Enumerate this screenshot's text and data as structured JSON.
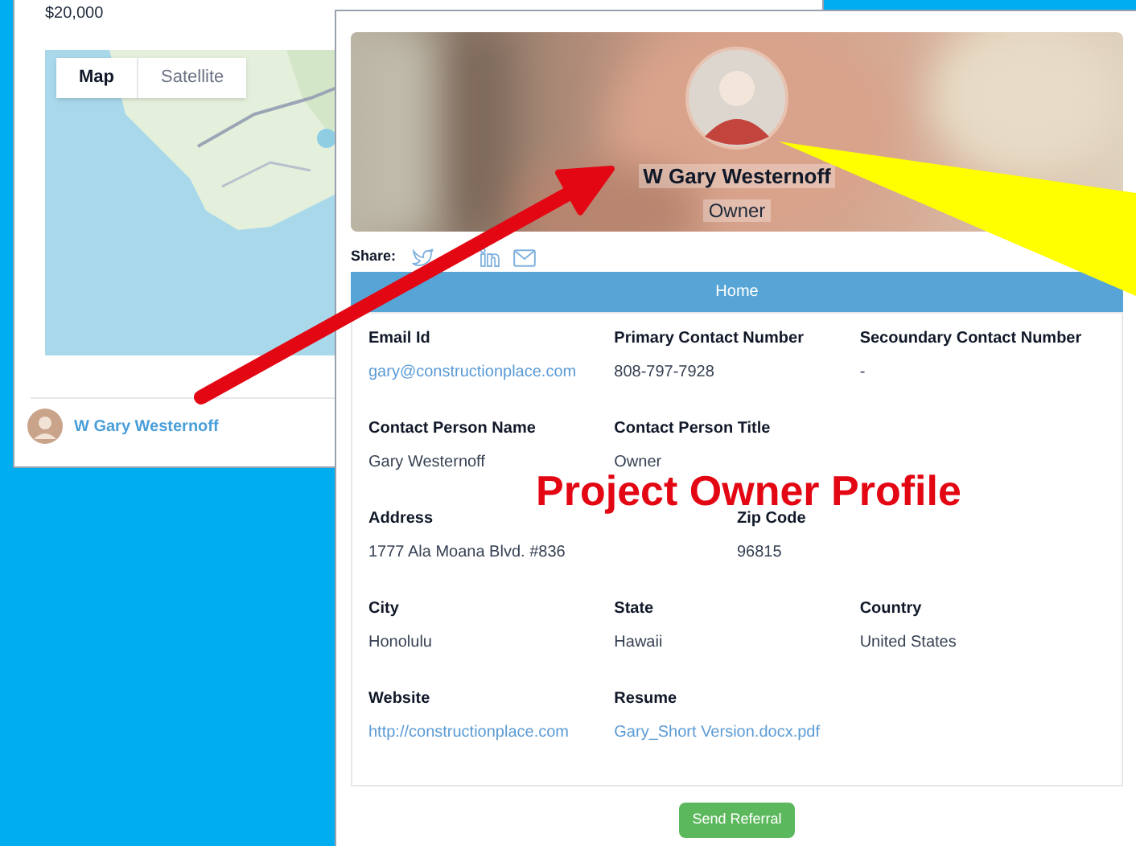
{
  "listing": {
    "price": "$20,000",
    "map": {
      "view_toggle": [
        {
          "label": "Map",
          "selected": true
        },
        {
          "label": "Satellite",
          "selected": false
        }
      ]
    },
    "owner_link": "W Gary Westernoff"
  },
  "profile": {
    "name": "W Gary Westernoff",
    "role": "Owner",
    "share_label": "Share:",
    "tab": "Home",
    "rows": [
      [
        {
          "label": "Email Id",
          "value": "gary@constructionplace.com",
          "kind": "link"
        },
        {
          "label": "Primary Contact Number",
          "value": "808-797-7928",
          "kind": "text"
        },
        {
          "label": "Secoundary Contact Number",
          "value": "-",
          "kind": "text"
        }
      ],
      [
        {
          "label": "Contact Person Name",
          "value": "Gary Westernoff",
          "kind": "text"
        },
        {
          "label": "Contact Person Title",
          "value": "Owner",
          "kind": "text"
        }
      ],
      [
        {
          "label": "Address",
          "value": "1777 Ala Moana Blvd. #836",
          "kind": "text"
        },
        {
          "label": "Zip Code",
          "value": "96815",
          "kind": "text"
        }
      ],
      [
        {
          "label": "City",
          "value": "Honolulu",
          "kind": "text"
        },
        {
          "label": "State",
          "value": "Hawaii",
          "kind": "text"
        },
        {
          "label": "Country",
          "value": "United States",
          "kind": "text"
        }
      ],
      [
        {
          "label": "Website",
          "value": "http://constructionplace.com",
          "kind": "link"
        },
        {
          "label": "Resume",
          "value": "Gary_Short Version.docx.pdf",
          "kind": "link"
        }
      ]
    ],
    "button": "Send Referral"
  },
  "annotation": {
    "text": "Project Owner Profile"
  }
}
